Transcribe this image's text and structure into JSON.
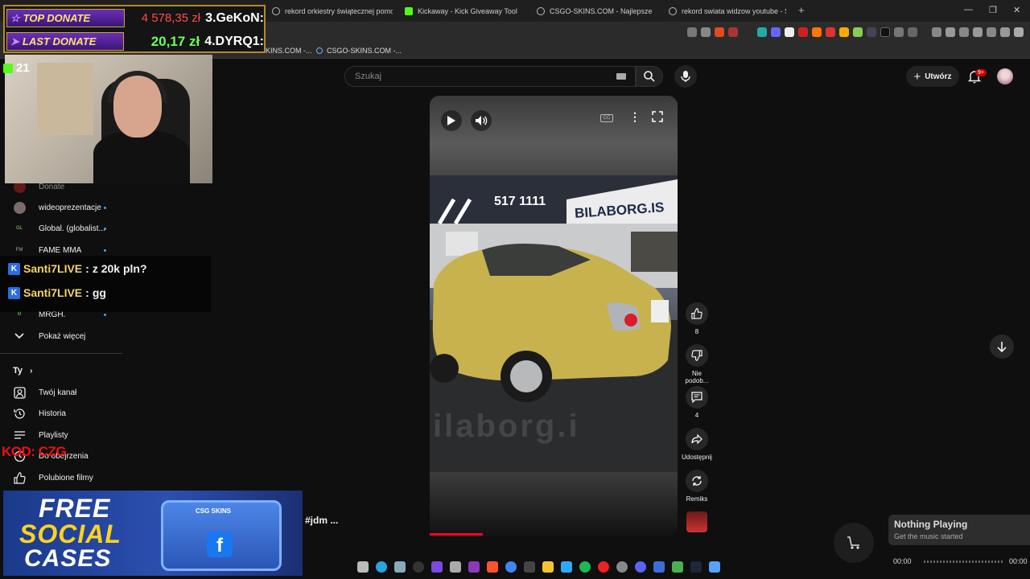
{
  "browser": {
    "tabs": [
      {
        "title": "rekord orkiestry świątecznej pomocy",
        "icon": "google-icon"
      },
      {
        "title": "Kickaway - Kick Giveaway Tool",
        "icon": "kick-icon"
      },
      {
        "title": "CSGO-SKINS.COM - Najlepsze Skrzy",
        "icon": "globe-icon"
      },
      {
        "title": "rekord swiata widzow youtube - Szuk",
        "icon": "google-icon"
      }
    ],
    "new_tab": "+",
    "bookmarks": [
      {
        "label": "KINS.COM -..."
      },
      {
        "label": "CSGO-SKINS.COM -..."
      }
    ]
  },
  "youtube": {
    "search_placeholder": "Szukaj",
    "create_label": "Utwórz",
    "notif_badge": "9+"
  },
  "sidebar": {
    "subs": [
      {
        "label": "Donate",
        "live": false
      },
      {
        "label": "wideoprezentacje",
        "live": true
      },
      {
        "label": "Global. (globalist...",
        "live": true
      },
      {
        "label": "FAME MMA",
        "live": true
      },
      {
        "label": "MRGH.",
        "live": true
      }
    ],
    "show_more": "Pokaż więcej",
    "you_header": "Ty",
    "you_items": [
      {
        "label": "Twój kanał",
        "icon": "channel-icon"
      },
      {
        "label": "Historia",
        "icon": "history-icon"
      },
      {
        "label": "Playlisty",
        "icon": "playlist-icon"
      },
      {
        "label": "Do obejrzenia",
        "icon": "watch-later-icon"
      },
      {
        "label": "Polubione filmy",
        "icon": "like-icon"
      }
    ]
  },
  "overlay": {
    "top_donate": {
      "tag": "TOP DONATE",
      "amount": "4 578,35 zł",
      "name": "3.GeKoN:"
    },
    "last_donate": {
      "tag": "LAST DONATE",
      "amount": "20,17 zł",
      "name": "4.DYRQ1:"
    },
    "viewer_count": "21",
    "chat": [
      {
        "user": "Santi7LIVE",
        "sep": " : ",
        "text": "z 20k pln?"
      },
      {
        "user": "Santi7LIVE",
        "sep": " : ",
        "text": "gg"
      }
    ],
    "code": "KOD: CZG",
    "ad": {
      "line1": "FREE",
      "line2": "SOCIAL",
      "line3": "CASES",
      "brand": "CSG SKINS"
    }
  },
  "short": {
    "sign1": "517 1111",
    "sign2": "BILABORG.IS",
    "watermark": "ilaborg.i",
    "hashtag": "#jdm ...",
    "likes": "8",
    "dislike_label": "Nie podob...",
    "comments": "4",
    "share_label": "Udostępnij",
    "remix_label": "Remiks"
  },
  "music": {
    "title": "Nothing Playing",
    "subtitle": "Get the music started",
    "time_start": "00:00",
    "time_end": "00:00"
  },
  "colors": {
    "accent": "#ff0033",
    "kick": "#53fc18",
    "donate_border": "#b58a2a",
    "live": "#3ea6ff"
  }
}
